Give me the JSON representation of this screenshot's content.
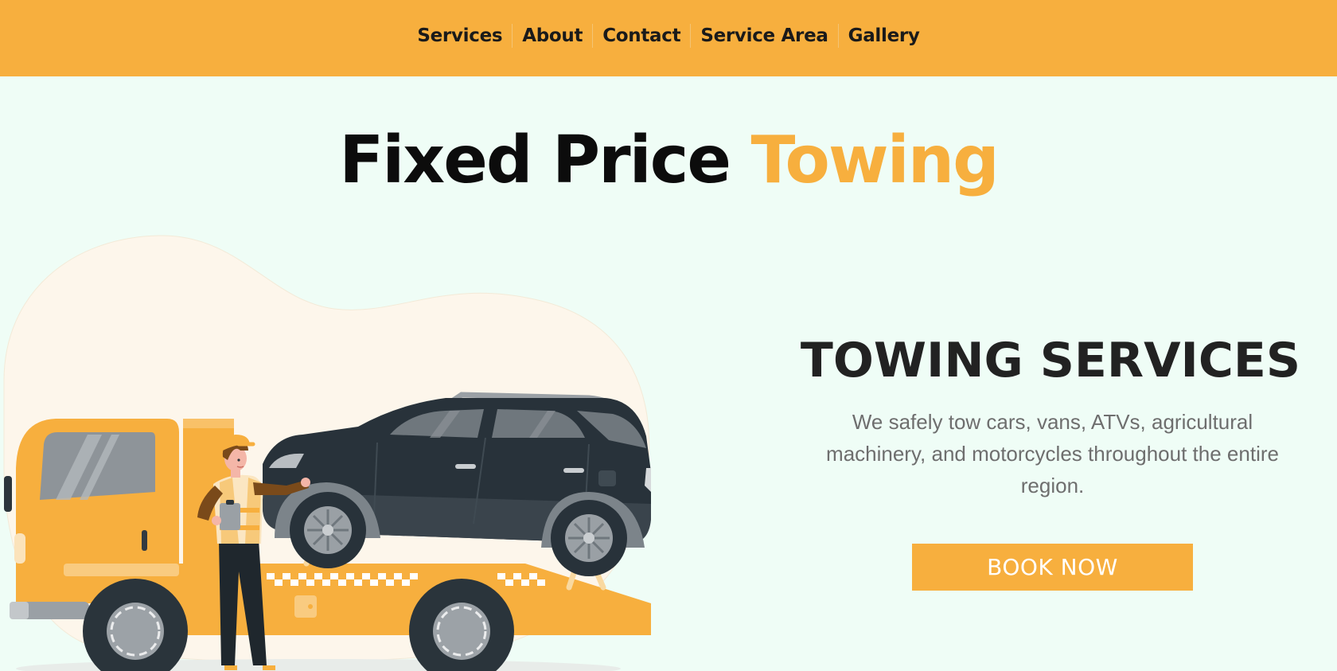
{
  "nav": {
    "items": [
      {
        "label": "Services"
      },
      {
        "label": "About"
      },
      {
        "label": "Contact"
      },
      {
        "label": "Service Area"
      },
      {
        "label": "Gallery"
      }
    ]
  },
  "hero": {
    "title_main": "Fixed Price ",
    "title_accent": "Towing"
  },
  "services": {
    "heading": "TOWING SERVICES",
    "description": "We safely tow cars, vans, ATVs, agricultural machinery, and motorcycles throughout the entire region.",
    "button_label": "BOOK NOW"
  },
  "colors": {
    "accent": "#f7af3e",
    "background": "#effdf6",
    "heading": "#222222",
    "body_text": "#6e6e6e",
    "car": "#28323a"
  },
  "icons": {
    "illustration": "tow-truck-with-suv-and-driver-illustration"
  }
}
